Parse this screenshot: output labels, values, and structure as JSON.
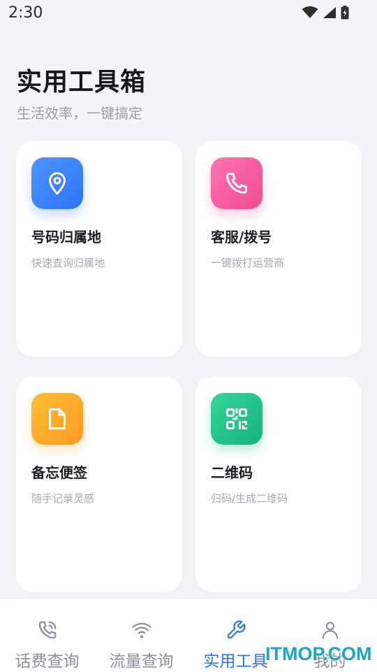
{
  "status_bar": {
    "time": "2:30"
  },
  "header": {
    "title": "实用工具箱",
    "subtitle": "生活效率，一键搞定"
  },
  "cards": [
    {
      "title": "号码归属地",
      "desc": "快速查询归属地",
      "icon": "location-pin-icon",
      "color": "#2f73f5"
    },
    {
      "title": "客服/拨号",
      "desc": "一键拨打运营商",
      "icon": "phone-icon",
      "color": "#ef4c8f"
    },
    {
      "title": "备忘便签",
      "desc": "随手记录灵感",
      "icon": "note-icon",
      "color": "#ff9a23"
    },
    {
      "title": "二维码",
      "desc": "归码/生成二维码",
      "icon": "qr-code-icon",
      "color": "#16b47c"
    }
  ],
  "bottom_nav": [
    {
      "label": "话费查询",
      "icon": "phone-call-icon",
      "active": false
    },
    {
      "label": "流量查询",
      "icon": "wifi-icon",
      "active": false
    },
    {
      "label": "实用工具",
      "icon": "wrench-icon",
      "active": true
    },
    {
      "label": "我的",
      "icon": "user-icon",
      "active": false
    }
  ],
  "watermark": "ITMOP.COM",
  "colors": {
    "accent": "#2f73f5",
    "background": "#f4f5f9",
    "inactive_nav": "#8d9099"
  }
}
